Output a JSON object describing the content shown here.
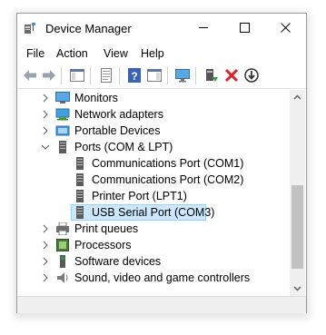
{
  "window": {
    "title": "Device Manager"
  },
  "menu": [
    {
      "label": "File"
    },
    {
      "label": "Action"
    },
    {
      "label": "View"
    },
    {
      "label": "Help"
    }
  ],
  "toolbar": {
    "icons": [
      "back-icon",
      "forward-icon",
      "show-hide-console-tree-icon",
      "properties-icon",
      "help-icon",
      "action-pane-icon",
      "monitor-icon",
      "update-driver-icon",
      "uninstall-icon",
      "disable-icon"
    ]
  },
  "tree": {
    "items": [
      {
        "label": "Monitors",
        "icon": "monitor-icon",
        "expanded": false
      },
      {
        "label": "Network adapters",
        "icon": "network-adapter-icon",
        "expanded": false
      },
      {
        "label": "Portable Devices",
        "icon": "portable-device-icon",
        "expanded": false
      },
      {
        "label": "Ports (COM & LPT)",
        "icon": "port-icon",
        "expanded": true
      },
      {
        "label": "Communications Port (COM1)",
        "icon": "port-icon",
        "child": true
      },
      {
        "label": "Communications Port (COM2)",
        "icon": "port-icon",
        "child": true
      },
      {
        "label": "Printer Port (LPT1)",
        "icon": "port-icon",
        "child": true
      },
      {
        "label": "USB Serial Port (COM3)",
        "icon": "port-icon",
        "child": true,
        "selected": true
      },
      {
        "label": "Print queues",
        "icon": "printer-icon",
        "expanded": false
      },
      {
        "label": "Processors",
        "icon": "processor-icon",
        "expanded": false
      },
      {
        "label": "Software devices",
        "icon": "software-device-icon",
        "expanded": false
      },
      {
        "label": "Sound, video and game controllers",
        "icon": "speaker-icon",
        "expanded": false
      }
    ]
  },
  "colors": {
    "selection": "#cce8ff",
    "selection_border": "#99d1ff",
    "close_red": "#e81123"
  }
}
